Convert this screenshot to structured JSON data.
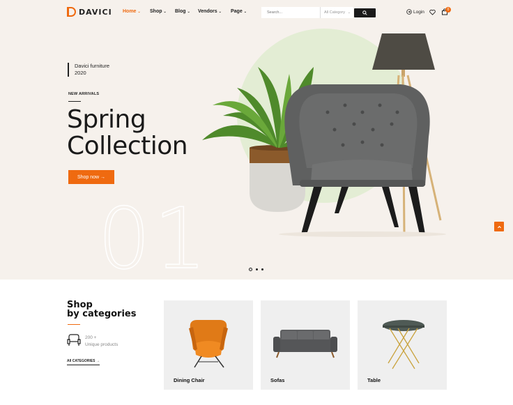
{
  "brand": {
    "name": "DAVICI",
    "accent": "#ef6a10"
  },
  "nav": {
    "items": [
      {
        "label": "Home",
        "active": true
      },
      {
        "label": "Shop",
        "active": false
      },
      {
        "label": "Blog",
        "active": false
      },
      {
        "label": "Vendors",
        "active": false
      },
      {
        "label": "Page",
        "active": false
      }
    ]
  },
  "search": {
    "placeholder": "Search...",
    "category": "All Category",
    "icon": "search-icon"
  },
  "account": {
    "login_label": "Login",
    "cart_count": "0"
  },
  "hero": {
    "tagline_line1": "Davici furniture",
    "tagline_line2": "2020",
    "label": "NEW ARRIVALS",
    "title_line1": "Spring",
    "title_line2": "Collection",
    "button_label": "Shop now →",
    "slide_number": "01",
    "slides": 3,
    "active_slide": 1
  },
  "categories": {
    "heading_line1": "Shop",
    "heading_line2": "by categories",
    "count_line1": "200 +",
    "count_line2": "Unique products",
    "all_link": "All CATEGORIES  →",
    "cards": [
      {
        "label": "Dining Chair",
        "icon": "armchair-image"
      },
      {
        "label": "Sofas",
        "icon": "sofa-image"
      },
      {
        "label": "Table",
        "icon": "side-table-image"
      }
    ]
  }
}
